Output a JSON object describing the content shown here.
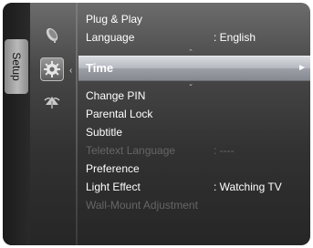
{
  "sidebar": {
    "tab_label": "Setup",
    "icons": [
      "satellite-dish-icon",
      "gear-icon",
      "signal-icon"
    ]
  },
  "menu": {
    "items": [
      {
        "label": "Plug & Play",
        "value": "",
        "enabled": true
      },
      {
        "label": "Language",
        "value": ": English",
        "enabled": true
      },
      {
        "label": "Time",
        "value": "",
        "enabled": true,
        "selected": true,
        "arrow": "►"
      },
      {
        "label": "Change PIN",
        "value": "",
        "enabled": true
      },
      {
        "label": "Parental  Lock",
        "value": "",
        "enabled": true
      },
      {
        "label": "Subtitle",
        "value": "",
        "enabled": true
      },
      {
        "label": "Teletext Language",
        "value": ": ----",
        "enabled": false
      },
      {
        "label": "Preference",
        "value": "",
        "enabled": true
      },
      {
        "label": "Light Effect",
        "value": ": Watching TV",
        "enabled": true
      },
      {
        "label": "Wall-Mount Adjustment",
        "value": "",
        "enabled": false
      }
    ],
    "scroll_up": "⌃",
    "scroll_down": "⌄"
  },
  "colors": {
    "text": "#ffffff",
    "disabled_text": "#666666",
    "highlight": "#b4b8be"
  }
}
